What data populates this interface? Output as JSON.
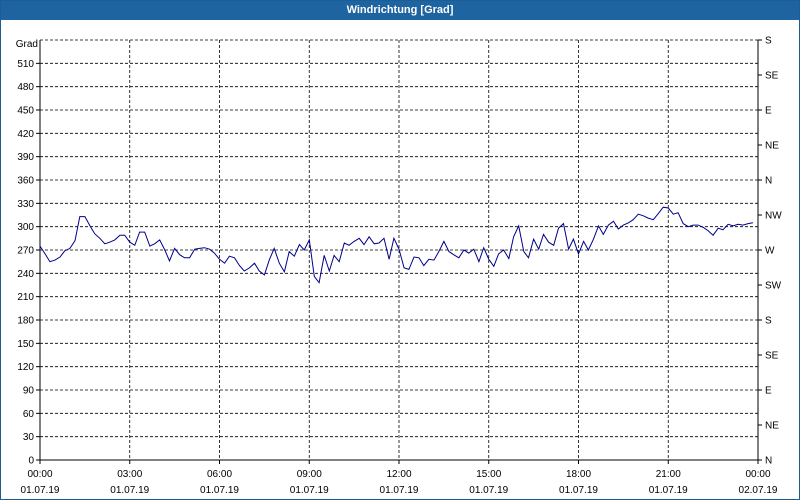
{
  "window": {
    "title": "Windrichtung [Grad]"
  },
  "chart_data": {
    "type": "line",
    "title": "Windrichtung [Grad]",
    "ylabel": "Grad",
    "ylim": [
      0,
      540
    ],
    "yticks": [
      0,
      30,
      60,
      90,
      120,
      150,
      180,
      210,
      240,
      270,
      300,
      330,
      360,
      390,
      420,
      450,
      480,
      510
    ],
    "right_ticks": [
      {
        "value": 0,
        "label": "N"
      },
      {
        "value": 45,
        "label": "NE"
      },
      {
        "value": 90,
        "label": "E"
      },
      {
        "value": 135,
        "label": "SE"
      },
      {
        "value": 180,
        "label": "S"
      },
      {
        "value": 225,
        "label": "SW"
      },
      {
        "value": 270,
        "label": "W"
      },
      {
        "value": 315,
        "label": "NW"
      },
      {
        "value": 360,
        "label": "N"
      },
      {
        "value": 405,
        "label": "NE"
      },
      {
        "value": 450,
        "label": "E"
      },
      {
        "value": 495,
        "label": "SE"
      },
      {
        "value": 540,
        "label": "S"
      }
    ],
    "xlim_hours": [
      0,
      24
    ],
    "xticks": [
      {
        "h": 0,
        "time": "00:00",
        "date": "01.07.19"
      },
      {
        "h": 3,
        "time": "03:00",
        "date": "01.07.19"
      },
      {
        "h": 6,
        "time": "06:00",
        "date": "01.07.19"
      },
      {
        "h": 9,
        "time": "09:00",
        "date": "01.07.19"
      },
      {
        "h": 12,
        "time": "12:00",
        "date": "01.07.19"
      },
      {
        "h": 15,
        "time": "15:00",
        "date": "01.07.19"
      },
      {
        "h": 18,
        "time": "18:00",
        "date": "01.07.19"
      },
      {
        "h": 21,
        "time": "21:00",
        "date": "01.07.19"
      },
      {
        "h": 24,
        "time": "00:00",
        "date": "02.07.19"
      }
    ],
    "grid": true,
    "series_color": "#00008b",
    "series": [
      {
        "name": "",
        "points": [
          [
            0.0,
            275
          ],
          [
            0.17,
            265
          ],
          [
            0.33,
            255
          ],
          [
            0.5,
            257
          ],
          [
            0.67,
            261
          ],
          [
            0.83,
            269
          ],
          [
            1.0,
            272
          ],
          [
            1.17,
            282
          ],
          [
            1.33,
            313
          ],
          [
            1.5,
            313
          ],
          [
            1.67,
            301
          ],
          [
            1.83,
            291
          ],
          [
            2.0,
            285
          ],
          [
            2.17,
            278
          ],
          [
            2.33,
            280
          ],
          [
            2.5,
            283
          ],
          [
            2.67,
            289
          ],
          [
            2.83,
            289
          ],
          [
            3.0,
            280
          ],
          [
            3.17,
            276
          ],
          [
            3.33,
            293
          ],
          [
            3.5,
            293
          ],
          [
            3.67,
            275
          ],
          [
            3.83,
            278
          ],
          [
            4.0,
            283
          ],
          [
            4.17,
            270
          ],
          [
            4.33,
            256
          ],
          [
            4.5,
            272
          ],
          [
            4.67,
            264
          ],
          [
            4.83,
            260
          ],
          [
            5.0,
            260
          ],
          [
            5.17,
            271
          ],
          [
            5.33,
            272
          ],
          [
            5.5,
            273
          ],
          [
            5.67,
            271
          ],
          [
            5.83,
            266
          ],
          [
            6.0,
            258
          ],
          [
            6.17,
            253
          ],
          [
            6.33,
            262
          ],
          [
            6.5,
            260
          ],
          [
            6.67,
            250
          ],
          [
            6.83,
            243
          ],
          [
            7.0,
            247
          ],
          [
            7.17,
            253
          ],
          [
            7.33,
            243
          ],
          [
            7.5,
            238
          ],
          [
            7.67,
            258
          ],
          [
            7.83,
            272
          ],
          [
            8.0,
            253
          ],
          [
            8.17,
            242
          ],
          [
            8.33,
            268
          ],
          [
            8.5,
            262
          ],
          [
            8.67,
            277
          ],
          [
            8.83,
            270
          ],
          [
            9.0,
            283
          ],
          [
            9.17,
            236
          ],
          [
            9.33,
            228
          ],
          [
            9.5,
            263
          ],
          [
            9.67,
            243
          ],
          [
            9.83,
            263
          ],
          [
            10.0,
            255
          ],
          [
            10.17,
            279
          ],
          [
            10.33,
            276
          ],
          [
            10.5,
            281
          ],
          [
            10.67,
            285
          ],
          [
            10.83,
            277
          ],
          [
            11.0,
            287
          ],
          [
            11.17,
            278
          ],
          [
            11.33,
            279
          ],
          [
            11.5,
            285
          ],
          [
            11.67,
            258
          ],
          [
            11.83,
            285
          ],
          [
            12.0,
            271
          ],
          [
            12.17,
            247
          ],
          [
            12.33,
            245
          ],
          [
            12.5,
            261
          ],
          [
            12.67,
            260
          ],
          [
            12.83,
            250
          ],
          [
            13.0,
            258
          ],
          [
            13.17,
            257
          ],
          [
            13.33,
            268
          ],
          [
            13.5,
            281
          ],
          [
            13.67,
            268
          ],
          [
            13.83,
            264
          ],
          [
            14.0,
            260
          ],
          [
            14.17,
            270
          ],
          [
            14.33,
            266
          ],
          [
            14.5,
            271
          ],
          [
            14.67,
            255
          ],
          [
            14.83,
            273
          ],
          [
            15.0,
            258
          ],
          [
            15.17,
            249
          ],
          [
            15.33,
            265
          ],
          [
            15.5,
            270
          ],
          [
            15.67,
            259
          ],
          [
            15.83,
            287
          ],
          [
            16.0,
            301
          ],
          [
            16.17,
            268
          ],
          [
            16.33,
            260
          ],
          [
            16.5,
            284
          ],
          [
            16.67,
            271
          ],
          [
            16.83,
            290
          ],
          [
            17.0,
            280
          ],
          [
            17.17,
            276
          ],
          [
            17.33,
            298
          ],
          [
            17.5,
            304
          ],
          [
            17.67,
            271
          ],
          [
            17.83,
            284
          ],
          [
            18.0,
            265
          ],
          [
            18.17,
            281
          ],
          [
            18.33,
            270
          ],
          [
            18.5,
            284
          ],
          [
            18.67,
            301
          ],
          [
            18.83,
            290
          ],
          [
            19.0,
            302
          ],
          [
            19.17,
            307
          ],
          [
            19.33,
            297
          ],
          [
            19.5,
            302
          ],
          [
            19.67,
            305
          ],
          [
            19.83,
            309
          ],
          [
            20.0,
            316
          ],
          [
            20.17,
            314
          ],
          [
            20.33,
            311
          ],
          [
            20.5,
            309
          ],
          [
            20.67,
            317
          ],
          [
            20.83,
            325
          ],
          [
            21.0,
            324
          ],
          [
            21.17,
            316
          ],
          [
            21.33,
            318
          ],
          [
            21.5,
            304
          ],
          [
            21.67,
            300
          ],
          [
            21.83,
            302
          ],
          [
            22.0,
            302
          ],
          [
            22.17,
            299
          ],
          [
            22.33,
            295
          ],
          [
            22.5,
            289
          ],
          [
            22.67,
            298
          ],
          [
            22.83,
            296
          ],
          [
            23.0,
            303
          ],
          [
            23.17,
            301
          ],
          [
            23.33,
            303
          ],
          [
            23.5,
            302
          ],
          [
            23.67,
            304
          ],
          [
            23.83,
            305
          ]
        ]
      }
    ]
  }
}
